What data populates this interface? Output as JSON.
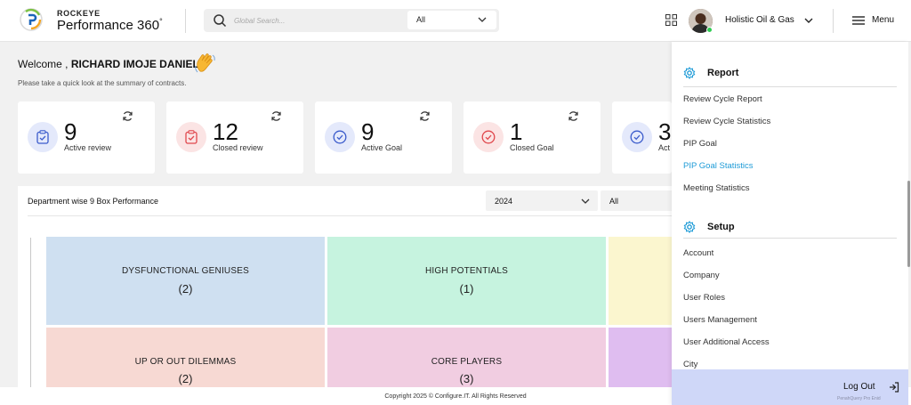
{
  "brand": {
    "top": "ROCKEYE",
    "main": "Performance 360",
    "mark": "°"
  },
  "search": {
    "placeholder": "Global Search...",
    "scope": "All"
  },
  "header": {
    "company": "Holistic Oil & Gas",
    "menu_label": "Menu"
  },
  "welcome": {
    "prefix": "Welcome ,",
    "name": "RICHARD IMOJE DANIEL",
    "emoji": "👋",
    "subtitle": "Please take a quick look at the summary of contracts."
  },
  "cards": [
    {
      "value": "9",
      "label": "Active review",
      "icon": "clipboard-check-icon",
      "color": "#3b5ccc",
      "bg": "#e4e9fb"
    },
    {
      "value": "12",
      "label": "Closed review",
      "icon": "clipboard-check-icon",
      "color": "#e0474c",
      "bg": "#fbe4e4"
    },
    {
      "value": "9",
      "label": "Active Goal",
      "icon": "check-circle-icon",
      "color": "#3b5ccc",
      "bg": "#e4e9fb"
    },
    {
      "value": "1",
      "label": "Closed Goal",
      "icon": "check-circle-icon",
      "color": "#e0474c",
      "bg": "#fbe4e4"
    },
    {
      "value": "3",
      "label": "Act",
      "icon": "check-circle-icon",
      "color": "#3b5ccc",
      "bg": "#e4e9fb"
    }
  ],
  "performance": {
    "title": "Department wise 9 Box Performance",
    "year": "2024",
    "filter": "All",
    "boxes": [
      {
        "title": "DYSFUNCTIONAL GENIUSES",
        "count": "(2)",
        "color": "#cfe0f1"
      },
      {
        "title": "HIGH POTENTIALS",
        "count": "(1)",
        "color": "#c6f3df"
      },
      {
        "title": "",
        "count": "",
        "color": "#fbf6cf"
      },
      {
        "title": "UP OR OUT DILEMMAS",
        "count": "(2)",
        "color": "#f7d9d3"
      },
      {
        "title": "CORE PLAYERS",
        "count": "(3)",
        "color": "#f1cde1"
      },
      {
        "title": "",
        "count": "",
        "color": "#dfbdf0"
      }
    ]
  },
  "footer": {
    "text": "Copyright 2025 © Configure.IT. All Rights Reserved"
  },
  "side_menu": {
    "report": {
      "title": "Report",
      "items": [
        "Review Cycle Report",
        "Review Cycle Statistics",
        "PIP Goal",
        "PIP Goal Statistics",
        "Meeting Statistics"
      ],
      "active": "PIP Goal Statistics"
    },
    "setup": {
      "title": "Setup",
      "items": [
        "Account",
        "Company",
        "User Roles",
        "Users Management",
        "User Additional Access",
        "City"
      ]
    },
    "logout": {
      "label": "Log Out",
      "sub": "PenahQuery Pro Enid"
    }
  }
}
